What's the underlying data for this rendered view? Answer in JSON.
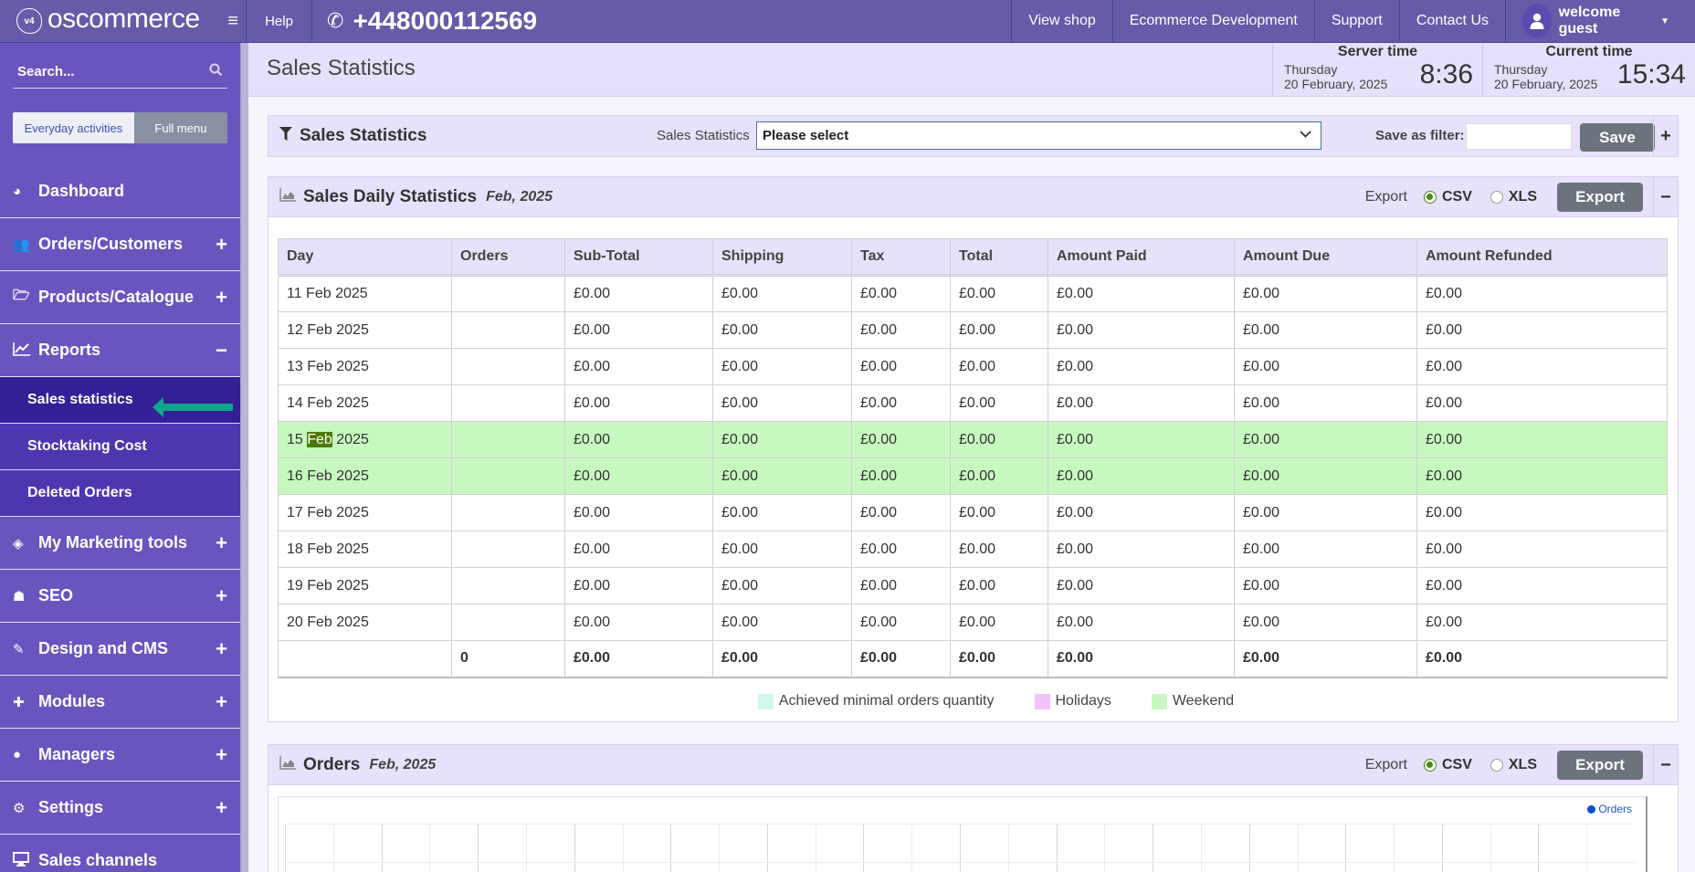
{
  "topbar": {
    "logo_text": "oscommerce",
    "logo_badge": "v4",
    "help_label": "Help",
    "phone": "+448000112569",
    "links": [
      "View shop",
      "Ecommerce Development",
      "Support",
      "Contact Us"
    ],
    "user_label": "welcome guest"
  },
  "sidebar": {
    "search_placeholder": "Search...",
    "toggle": {
      "everyday": "Everyday activities",
      "full": "Full menu"
    },
    "items": [
      {
        "label": "Dashboard",
        "icon": "dashboard-icon",
        "sign": ""
      },
      {
        "label": "Orders/Customers",
        "icon": "users-icon",
        "sign": "+"
      },
      {
        "label": "Products/Catalogue",
        "icon": "folder-icon",
        "sign": "+"
      },
      {
        "label": "Reports",
        "icon": "line-chart-icon",
        "sign": "−"
      },
      {
        "label": "My Marketing tools",
        "icon": "ticket-icon",
        "sign": "+"
      },
      {
        "label": "SEO",
        "icon": "sitemap-icon",
        "sign": "+"
      },
      {
        "label": "Design and CMS",
        "icon": "brush-icon",
        "sign": "+"
      },
      {
        "label": "Modules",
        "icon": "puzzle-icon",
        "sign": "+"
      },
      {
        "label": "Managers",
        "icon": "user-icon",
        "sign": "+"
      },
      {
        "label": "Settings",
        "icon": "cogs-icon",
        "sign": "+"
      },
      {
        "label": "Sales channels",
        "icon": "monitor-icon",
        "sign": ""
      }
    ],
    "reports_sub": [
      "Sales statistics",
      "Stocktaking Cost",
      "Deleted Orders"
    ],
    "active_sub": "Sales statistics"
  },
  "header": {
    "page_title": "Sales Statistics",
    "server_time": {
      "label": "Server time",
      "weekday": "Thursday",
      "date": "20 February, 2025",
      "clock": "8:36"
    },
    "current_time": {
      "label": "Current time",
      "weekday": "Thursday",
      "date": "20 February, 2025",
      "clock": "15:34"
    }
  },
  "filter": {
    "title": "Sales Statistics",
    "select_label": "Sales Statistics",
    "select_value": "Please select",
    "save_label": "Save as filter:",
    "save_input_value": "",
    "save_button": "Save",
    "expand_sign": "+"
  },
  "daily": {
    "title": "Sales Daily Statistics",
    "period": "Feb, 2025",
    "export_label": "Export",
    "formats": [
      "CSV",
      "XLS"
    ],
    "selected_format": "CSV",
    "export_button": "Export",
    "collapse_sign": "−",
    "columns": [
      "Day",
      "Orders",
      "Sub-Total",
      "Shipping",
      "Tax",
      "Total",
      "Amount Paid",
      "Amount Due",
      "Amount Refunded"
    ],
    "rows": [
      {
        "day": "11 Feb 2025",
        "orders": "",
        "subtotal": "£0.00",
        "shipping": "£0.00",
        "tax": "£0.00",
        "total": "£0.00",
        "paid": "£0.00",
        "due": "£0.00",
        "refunded": "£0.00",
        "weekend": false
      },
      {
        "day": "12 Feb 2025",
        "orders": "",
        "subtotal": "£0.00",
        "shipping": "£0.00",
        "tax": "£0.00",
        "total": "£0.00",
        "paid": "£0.00",
        "due": "£0.00",
        "refunded": "£0.00",
        "weekend": false
      },
      {
        "day": "13 Feb 2025",
        "orders": "",
        "subtotal": "£0.00",
        "shipping": "£0.00",
        "tax": "£0.00",
        "total": "£0.00",
        "paid": "£0.00",
        "due": "£0.00",
        "refunded": "£0.00",
        "weekend": false
      },
      {
        "day": "14 Feb 2025",
        "orders": "",
        "subtotal": "£0.00",
        "shipping": "£0.00",
        "tax": "£0.00",
        "total": "£0.00",
        "paid": "£0.00",
        "due": "£0.00",
        "refunded": "£0.00",
        "weekend": false
      },
      {
        "day": "15 Feb 2025",
        "orders": "",
        "subtotal": "£0.00",
        "shipping": "£0.00",
        "tax": "£0.00",
        "total": "£0.00",
        "paid": "£0.00",
        "due": "£0.00",
        "refunded": "£0.00",
        "weekend": true
      },
      {
        "day": "16 Feb 2025",
        "orders": "",
        "subtotal": "£0.00",
        "shipping": "£0.00",
        "tax": "£0.00",
        "total": "£0.00",
        "paid": "£0.00",
        "due": "£0.00",
        "refunded": "£0.00",
        "weekend": true
      },
      {
        "day": "17 Feb 2025",
        "orders": "",
        "subtotal": "£0.00",
        "shipping": "£0.00",
        "tax": "£0.00",
        "total": "£0.00",
        "paid": "£0.00",
        "due": "£0.00",
        "refunded": "£0.00",
        "weekend": false
      },
      {
        "day": "18 Feb 2025",
        "orders": "",
        "subtotal": "£0.00",
        "shipping": "£0.00",
        "tax": "£0.00",
        "total": "£0.00",
        "paid": "£0.00",
        "due": "£0.00",
        "refunded": "£0.00",
        "weekend": false
      },
      {
        "day": "19 Feb 2025",
        "orders": "",
        "subtotal": "£0.00",
        "shipping": "£0.00",
        "tax": "£0.00",
        "total": "£0.00",
        "paid": "£0.00",
        "due": "£0.00",
        "refunded": "£0.00",
        "weekend": false
      },
      {
        "day": "20 Feb 2025",
        "orders": "",
        "subtotal": "£0.00",
        "shipping": "£0.00",
        "tax": "£0.00",
        "total": "£0.00",
        "paid": "£0.00",
        "due": "£0.00",
        "refunded": "£0.00",
        "weekend": false
      }
    ],
    "totals": {
      "day": "",
      "orders": "0",
      "subtotal": "£0.00",
      "shipping": "£0.00",
      "tax": "£0.00",
      "total": "£0.00",
      "paid": "£0.00",
      "due": "£0.00",
      "refunded": "£0.00"
    },
    "highlighted_text": "Feb",
    "legend": [
      {
        "label": "Achieved minimal orders quantity",
        "color": "#d3f5ee"
      },
      {
        "label": "Holidays",
        "color": "#f0c4fb"
      },
      {
        "label": "Weekend",
        "color": "#c7f8c0"
      }
    ]
  },
  "orders_panel": {
    "title": "Orders",
    "period": "Feb, 2025",
    "export_label": "Export",
    "formats": [
      "CSV",
      "XLS"
    ],
    "selected_format": "CSV",
    "export_button": "Export",
    "collapse_sign": "−",
    "chart_legend": "Orders"
  },
  "colors": {
    "topbar": "#655ba9",
    "sidebar": "#6a55bf",
    "sidebar_active": "#351f96",
    "panel_header": "#e7e1fc",
    "weekend_row": "#c7f8c0",
    "button": "#6b737c",
    "radio_on": "#4b8a10",
    "arrow": "#0fa68c"
  }
}
